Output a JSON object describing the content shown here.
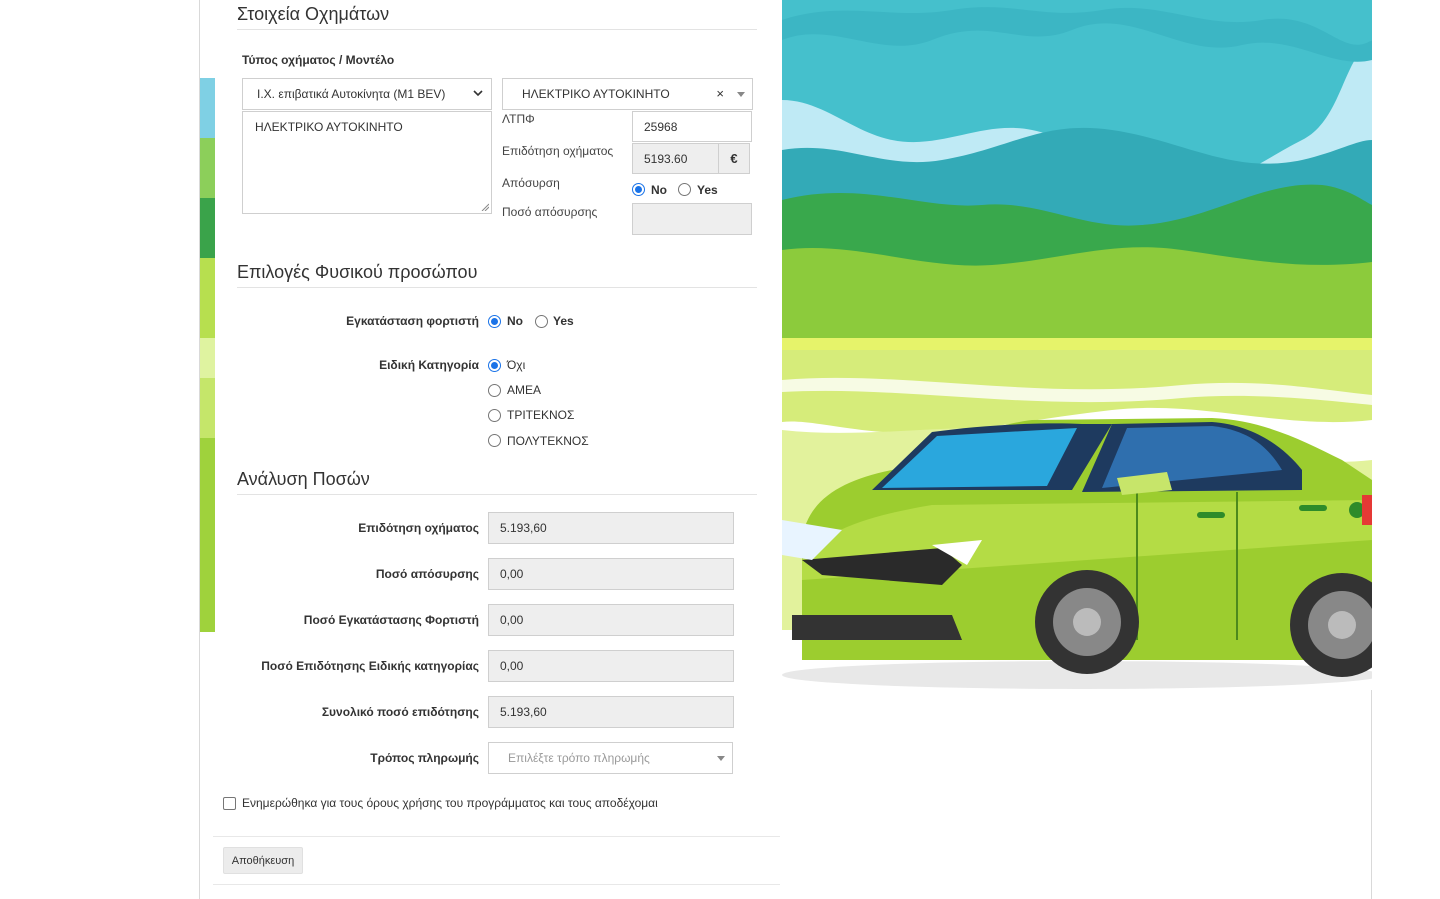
{
  "vehicle_section": {
    "title": "Στοιχεία Οχημάτων",
    "type_label": "Τύπος οχήματος / Μοντέλο",
    "category_select": "Ι.Χ. επιβατικά Αυτοκίνητα (M1 BEV)",
    "model_select": "ΗΛΕΚΤΡΙΚΟ ΑΥΤΟΚΙΝΗΤΟ",
    "clear_symbol": "×",
    "description": "ΗΛΕΚΤΡΙΚΟ ΑΥΤΟΚΙΝΗΤΟ",
    "ltpf_label": "ΛΤΠΦ",
    "ltpf_value": "25968",
    "subsidy_label": "Επιδότηση οχήματος",
    "subsidy_value": "5193.60",
    "currency": "€",
    "withdrawal_label": "Απόσυρση",
    "withdrawal_no": "No",
    "withdrawal_yes": "Yes",
    "withdrawal_selected": "No",
    "withdrawal_amount_label": "Ποσό απόσυρσης",
    "withdrawal_amount_value": ""
  },
  "person_section": {
    "title": "Επιλογές Φυσικού προσώπου",
    "charger_label": "Εγκατάσταση φορτιστή",
    "charger_no": "No",
    "charger_yes": "Yes",
    "charger_selected": "No",
    "special_label": "Ειδική Κατηγορία",
    "special_options": [
      "Όχι",
      "ΑΜΕΑ",
      "ΤΡΙΤΕΚΝΟΣ",
      "ΠΟΛΥΤΕΚΝΟΣ"
    ],
    "special_selected": "Όχι"
  },
  "amounts_section": {
    "title": "Ανάλυση Ποσών",
    "rows": [
      {
        "label": "Επιδότηση οχήματος",
        "value": "5.193,60"
      },
      {
        "label": "Ποσό απόσυρσης",
        "value": "0,00"
      },
      {
        "label": "Ποσό Εγκατάστασης Φορτιστή",
        "value": "0,00"
      },
      {
        "label": "Ποσό Επιδότησης Ειδικής κατηγορίας",
        "value": "0,00"
      },
      {
        "label": "Συνολικό ποσό επιδότησης",
        "value": "5.193,60"
      }
    ],
    "payment_label": "Τρόπος πληρωμής",
    "payment_placeholder": "Επιλέξτε τρόπο πληρωμής"
  },
  "terms": {
    "text": "Ενημερώθηκα για τους όρους χρήσης του προγράμματος και τους αποδέχομαι",
    "checked": false
  },
  "actions": {
    "save_label": "Αποθήκευση"
  },
  "colors": {
    "radio_accent": "#1a73e8",
    "readonly_bg": "#eeeeee",
    "car_green": "#9ccd2f",
    "sky": "#bfeaf5",
    "hill_teal": "#2fb7c4"
  }
}
